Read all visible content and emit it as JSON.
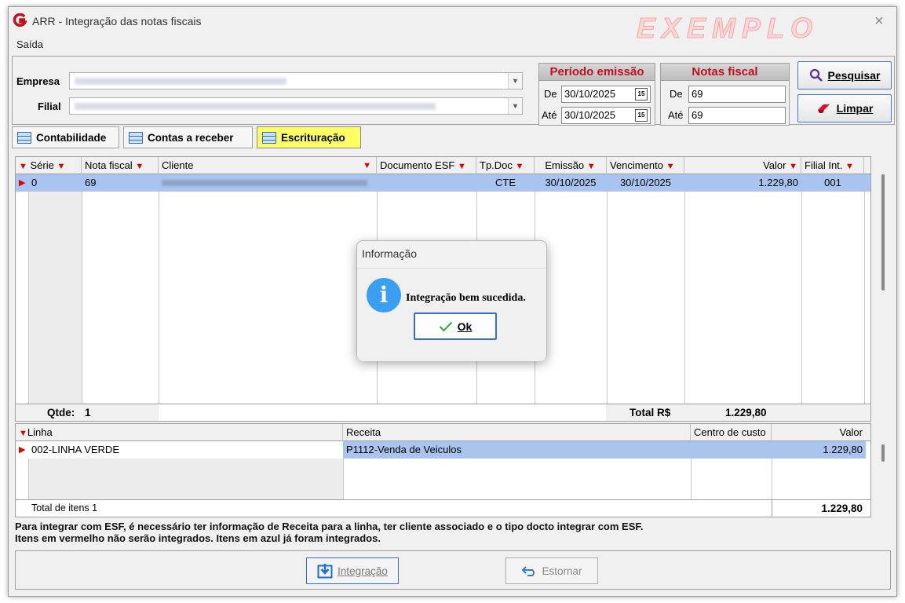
{
  "window": {
    "title": "ARR - Integração das notas fiscais",
    "watermark": "EXEMPLO",
    "close": "×"
  },
  "menu": {
    "items": [
      {
        "label": "Saída"
      }
    ]
  },
  "filters": {
    "empresa_label": "Empresa",
    "filial_label": "Filial",
    "periodo": {
      "title": "Período emissão",
      "de_label": "De",
      "ate_label": "Até",
      "de_value": "30/10/2025",
      "ate_value": "30/10/2025"
    },
    "notas": {
      "title": "Notas fiscal",
      "de_label": "De",
      "ate_label": "Até",
      "de_value": "69",
      "ate_value": "69"
    },
    "pesquisar_label": "Pesquisar",
    "limpar_label": "Limpar"
  },
  "tabs": [
    {
      "label": "Contabilidade",
      "active": false
    },
    {
      "label": "Contas a receber",
      "active": false
    },
    {
      "label": "Escrituração",
      "active": true
    }
  ],
  "grid": {
    "columns": [
      "Série",
      "Nota fiscal",
      "Cliente",
      "Documento ESF",
      "Tp.Doc",
      "Emissão",
      "Vencimento",
      "Valor",
      "Filial Int."
    ],
    "rows": [
      {
        "serie": "0",
        "nota": "69",
        "cliente": "",
        "doc_esf": "",
        "tp_doc": "CTE",
        "emissao": "30/10/2025",
        "vencimento": "30/10/2025",
        "valor": "1.229,80",
        "filial_int": "001"
      }
    ],
    "qtde_label": "Qtde:",
    "qtde_value": "1",
    "total_label": "Total R$",
    "total_value": "1.229,80"
  },
  "grid2": {
    "columns": [
      "Linha",
      "Receita",
      "Centro de custo",
      "Valor"
    ],
    "rows": [
      {
        "linha": "002-LINHA VERDE",
        "receita": "P1112-Venda de Veiculos",
        "centro": "",
        "valor": "1.229,80"
      }
    ],
    "total_itens_label": "Total de itens 1",
    "total_value": "1.229,80"
  },
  "info": {
    "line1": "Para integrar com ESF, é necessário ter informação de Receita para a linha, ter cliente associado e o tipo docto integrar com ESF.",
    "line2": "Itens em vermelho não serão integrados. Itens em azul já foram integrados."
  },
  "actions": {
    "integracao_label": "Integração",
    "estornar_label": "Estornar"
  },
  "dialog": {
    "title": "Informação",
    "message": "Integração bem sucedida.",
    "ok_label": "Ok"
  },
  "colors": {
    "accent": "#3a6ec4",
    "selected_row": "#a9c4ee",
    "header_red": "#c0101c",
    "active_tab": "#ffff66"
  }
}
